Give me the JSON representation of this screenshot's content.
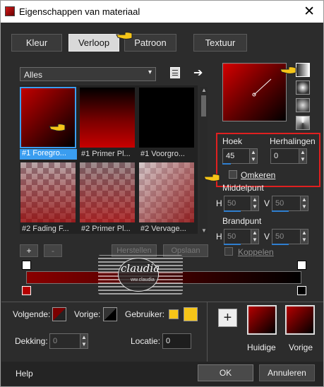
{
  "window": {
    "title": "Eigenschappen van materiaal",
    "close_glyph": "✕"
  },
  "tabs": [
    {
      "label": "Kleur",
      "selected": false
    },
    {
      "label": "Verloop",
      "selected": true
    },
    {
      "label": "Patroon",
      "selected": false
    },
    {
      "label": "Textuur",
      "selected": false
    }
  ],
  "filter": {
    "value": "Alles"
  },
  "gradients": [
    {
      "caption": "#1 Foregro...",
      "selected": true
    },
    {
      "caption": "#1 Primer Pl...",
      "selected": false
    },
    {
      "caption": "#1 Voorgro...",
      "selected": false
    },
    {
      "caption": "#2 Fading F...",
      "selected": false
    },
    {
      "caption": "#2 Primer Pl...",
      "selected": false
    },
    {
      "caption": "#2 Vervage...",
      "selected": false
    }
  ],
  "list_buttons": {
    "add": "+",
    "remove": "-",
    "left_hidden": "Herstellen",
    "right_hidden": "Opslaan"
  },
  "angle": {
    "label": "Hoek",
    "value": "45"
  },
  "repeats": {
    "label": "Herhalingen",
    "value": "0"
  },
  "invert": {
    "label": "Omkeren",
    "checked": false
  },
  "center": {
    "label": "Middelpunt",
    "h_label": "H",
    "h_value": "50",
    "v_label": "V",
    "v_value": "50"
  },
  "focal": {
    "label": "Brandpunt",
    "h_label": "H",
    "h_value": "50",
    "v_label": "V",
    "v_value": "50"
  },
  "link": {
    "label": "Koppelen",
    "checked": false
  },
  "watermark": {
    "text": "claudia",
    "sub": "ww.claudia"
  },
  "colors": {
    "next_label": "Volgende:",
    "prev_label": "Vorige:",
    "user_label": "Gebruiker:",
    "fg": "#7a0000",
    "bg": "#000000",
    "user": "#f5c518",
    "accent": "#3a9df0",
    "highlight": "#e02020"
  },
  "opacity": {
    "label": "Dekking:",
    "value": "0"
  },
  "location": {
    "label": "Locatie:",
    "value": "0"
  },
  "current_label": "Huidige",
  "previous_label": "Vorige",
  "add_plus": "+",
  "footer": {
    "help": "Help",
    "ok": "OK",
    "cancel": "Annuleren"
  }
}
